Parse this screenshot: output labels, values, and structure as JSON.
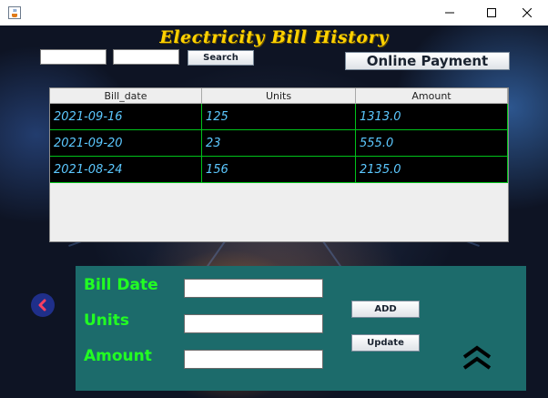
{
  "window": {
    "app_icon": "java-cup-icon"
  },
  "header": {
    "title": "Electricity Bill History"
  },
  "search": {
    "button_label": "Search",
    "field1_value": "",
    "field2_value": ""
  },
  "online_payment": {
    "label": "Online Payment"
  },
  "table": {
    "columns": [
      "Bill_date",
      "Units",
      "Amount"
    ],
    "rows": [
      [
        "2021-09-16",
        "125",
        "1313.0"
      ],
      [
        "2021-09-20",
        "23",
        "555.0"
      ],
      [
        "2021-08-24",
        "156",
        "2135.0"
      ]
    ]
  },
  "form": {
    "bill_date_label": "Bill Date",
    "units_label": "Units",
    "amount_label": "Amount",
    "add_label": "ADD",
    "update_label": "Update"
  },
  "colors": {
    "title": "#ffd200",
    "panel": "#1c6b6b",
    "label": "#22ff22",
    "cell_text": "#5cc8ff",
    "grid": "#00c21a"
  }
}
